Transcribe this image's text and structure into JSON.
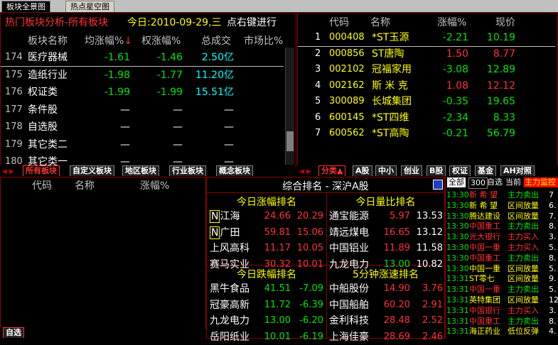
{
  "top_tabs": [
    "板块全景图",
    "热点星空图"
  ],
  "left_panel": {
    "title": "热门板块分析-所有板块",
    "date": "今日:2010-09-29,三",
    "hint": "点右键进行",
    "headers": [
      "板块名称",
      "均涨幅%",
      "权涨幅%",
      "总成交",
      "市场比%"
    ],
    "sort_mark": "↓",
    "rows": [
      {
        "no": "174",
        "name": "医疗器械",
        "avg": "-1.61",
        "wt": "-1.46",
        "vol": "2.50亿"
      },
      {
        "no": "175",
        "name": "造纸行业",
        "avg": "-1.98",
        "wt": "-1.77",
        "vol": "11.20亿"
      },
      {
        "no": "176",
        "name": "权证类",
        "avg": "-1.99",
        "wt": "-1.99",
        "vol": "15.51亿"
      },
      {
        "no": "177",
        "name": "条件股",
        "avg": "—",
        "wt": "—",
        "vol": "—"
      },
      {
        "no": "178",
        "name": "自选股",
        "avg": "—",
        "wt": "—",
        "vol": "—"
      },
      {
        "no": "179",
        "name": "其它类二",
        "avg": "—",
        "wt": "—",
        "vol": "—"
      },
      {
        "no": "180",
        "name": "其它类一",
        "avg": "—",
        "wt": "—",
        "vol": "—"
      }
    ],
    "tabs": [
      "所有板块",
      "自定义板块",
      "地区板块",
      "行业板块",
      "概念板块"
    ]
  },
  "right_panel": {
    "headers": [
      "代码",
      "名称",
      "涨幅%",
      "现价"
    ],
    "rows": [
      {
        "no": "1",
        "code": "000408",
        "name": "*ST玉源",
        "chg": "-2.21",
        "price": "10.19"
      },
      {
        "no": "2",
        "code": "000856",
        "name": "ST唐陶",
        "chg": "1.50",
        "price": "8.77"
      },
      {
        "no": "3",
        "code": "002102",
        "name": "冠福家用",
        "chg": "-3.08",
        "price": "12.89"
      },
      {
        "no": "4",
        "code": "002162",
        "name": "斯 米 克",
        "chg": "1.08",
        "price": "12.12"
      },
      {
        "no": "5",
        "code": "300089",
        "name": "长城集团",
        "chg": "-0.35",
        "price": "19.65"
      },
      {
        "no": "6",
        "code": "600145",
        "name": "*ST四维",
        "chg": "-2.34",
        "price": "8.33"
      },
      {
        "no": "7",
        "code": "600562",
        "name": "*ST高陶",
        "chg": "-0.21",
        "price": "56.79"
      }
    ],
    "tabs": [
      "分类▲",
      "A股",
      "中小",
      "创业",
      "B股",
      "权证",
      "基金",
      "AH对照"
    ]
  },
  "bottom_left": {
    "headers": [
      "代码",
      "名称",
      "涨幅%"
    ],
    "tab": "自选"
  },
  "ranking": {
    "title": "综合排名 - 深沪A股",
    "gain_title": "今日涨幅排名",
    "volratio_title": "今日量比排名",
    "drop_title": "今日跌幅排名",
    "speed_title": "5分钟涨速排名",
    "gain": [
      {
        "tag": "N",
        "name": "江海",
        "price": "24.66",
        "val": "20.29"
      },
      {
        "tag": "N",
        "name": "广田",
        "price": "59.81",
        "val": "15.06"
      },
      {
        "tag": "",
        "name": "上风高科",
        "price": "11.17",
        "val": "10.05"
      },
      {
        "tag": "",
        "name": "赛马实业",
        "price": "30.32",
        "val": "10.01"
      }
    ],
    "volratio": [
      {
        "name": "通宝能源",
        "price": "5.97",
        "val": "13.53"
      },
      {
        "name": "靖远煤电",
        "price": "16.65",
        "val": "13.12"
      },
      {
        "name": "中国铝业",
        "price": "11.89",
        "val": "11.58"
      },
      {
        "name": "九龙电力",
        "price": "13.00",
        "val": "10.82"
      }
    ],
    "drop": [
      {
        "name": "黑牛食品",
        "price": "41.51",
        "val": "-7.09"
      },
      {
        "name": "冠豪高新",
        "price": "11.72",
        "val": "-6.39"
      },
      {
        "name": "九龙电力",
        "price": "13.00",
        "val": "-6.20"
      },
      {
        "name": "岳阳纸业",
        "price": "10.01",
        "val": "-6.19"
      }
    ],
    "speed": [
      {
        "name": "中船股份",
        "price": "14.90",
        "val": "3.76"
      },
      {
        "name": "中国船舶",
        "price": "60.20",
        "val": "2.91"
      },
      {
        "name": "金利科技",
        "price": "28.48",
        "val": "2.52"
      },
      {
        "name": "上海佳豪",
        "price": "28.69",
        "val": "2.46"
      }
    ]
  },
  "monitor": {
    "tabs": [
      "全部",
      "300",
      "自选",
      "当前",
      "主力监控"
    ],
    "rows": [
      {
        "time": "13:30",
        "name": "新 希 望",
        "action": "主力卖出",
        "val": "7"
      },
      {
        "time": "13:30",
        "name": "新 希 望",
        "action": "区间放量",
        "val": "6."
      },
      {
        "time": "13:30",
        "name": "腾达建设",
        "action": "区间放量",
        "val": "7."
      },
      {
        "time": "13:30",
        "name": "中国重工",
        "action": "主力卖出",
        "val": "8."
      },
      {
        "time": "13:30",
        "name": "光大银行",
        "action": "主力买入",
        "val": "3."
      },
      {
        "time": "13:30",
        "name": "中国一重",
        "action": "主力买入",
        "val": "5."
      },
      {
        "time": "13:30",
        "name": "中国重工",
        "action": "主力卖出",
        "val": "8."
      },
      {
        "time": "13:30",
        "name": "中国一重",
        "action": "区间放量",
        "val": "5."
      },
      {
        "time": "13:31",
        "name": "ST零七",
        "action": "区间放量",
        "val": "9."
      },
      {
        "time": "13:31",
        "name": "中国一重",
        "action": "主力卖出",
        "val": "5."
      },
      {
        "time": "13:31",
        "name": "英特集团",
        "action": "区间放量",
        "val": "12"
      },
      {
        "time": "13:31",
        "name": "中国银行",
        "action": "主力买入",
        "val": "3."
      },
      {
        "time": "13:31",
        "name": "中国重工",
        "action": "主力卖出",
        "val": "8."
      },
      {
        "time": "13:31",
        "name": "海正药业",
        "action": "低位反弹",
        "val": "4."
      }
    ]
  },
  "colors": {
    "up": "#ff3232",
    "down": "#00e600",
    "accent": "#ffff00",
    "border": "#8a0000"
  }
}
